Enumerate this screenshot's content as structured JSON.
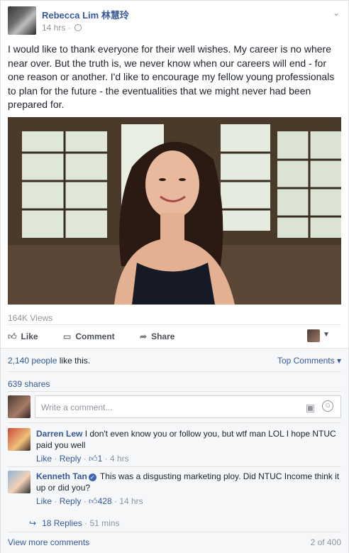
{
  "post": {
    "author": "Rebecca Lim 林慧玲",
    "time": "14 hrs ·",
    "text": "I would like to thank everyone for their well wishes. My career is no where near over. But the truth is, we never know when our careers will end - for one reason or another. I'd like to encourage my fellow young professionals to plan for the future - the eventualities that we might never had been prepared for."
  },
  "video": {
    "views": "164K Views"
  },
  "actions": {
    "like": "Like",
    "comment": "Comment",
    "share": "Share"
  },
  "reactions": {
    "likes_count": "2,140 people",
    "likes_suffix": " like this.",
    "top_comments": "Top Comments ▾",
    "shares": "639 shares"
  },
  "composer": {
    "placeholder": "Write a comment..."
  },
  "comments": [
    {
      "name": "Darren Lew",
      "text": " I don't even know you or follow you, but wtf man LOL I hope NTUC paid you well",
      "like": "Like",
      "reply": "Reply",
      "likes": "1",
      "time": "· 4 hrs"
    },
    {
      "name": "Kenneth Tan",
      "text": " This was a disgusting marketing ploy. Did NTUC Income think it up or did you?",
      "like": "Like",
      "reply": "Reply",
      "likes": "428",
      "time": "· 14 hrs"
    }
  ],
  "replies": {
    "label": "18 Replies",
    "time": "· 51 mins"
  },
  "footer": {
    "view_more": "View more comments",
    "count": "2 of 400"
  },
  "icons": [
    "globe-icon",
    "chevron-down-icon",
    "like-icon",
    "comment-icon",
    "share-icon",
    "camera-icon",
    "smile-icon",
    "thumb-up-icon",
    "reply-arrow-icon",
    "verified-icon"
  ],
  "colors": {
    "link": "#365899",
    "muted": "#90949c",
    "text": "#1d2129"
  }
}
